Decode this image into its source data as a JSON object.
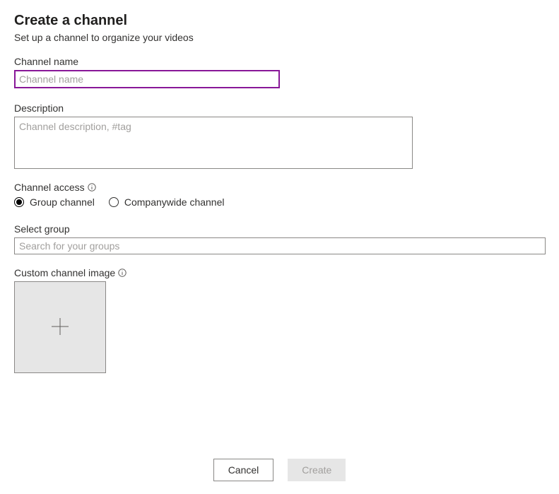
{
  "header": {
    "title": "Create a channel",
    "subtitle": "Set up a channel to organize your videos"
  },
  "channelName": {
    "label": "Channel name",
    "placeholder": "Channel name",
    "value": ""
  },
  "description": {
    "label": "Description",
    "placeholder": "Channel description, #tag",
    "value": ""
  },
  "channelAccess": {
    "label": "Channel access",
    "options": [
      {
        "label": "Group channel",
        "checked": true
      },
      {
        "label": "Companywide channel",
        "checked": false
      }
    ]
  },
  "selectGroup": {
    "label": "Select group",
    "placeholder": "Search for your groups",
    "value": ""
  },
  "customImage": {
    "label": "Custom channel image"
  },
  "buttons": {
    "cancel": "Cancel",
    "create": "Create"
  }
}
